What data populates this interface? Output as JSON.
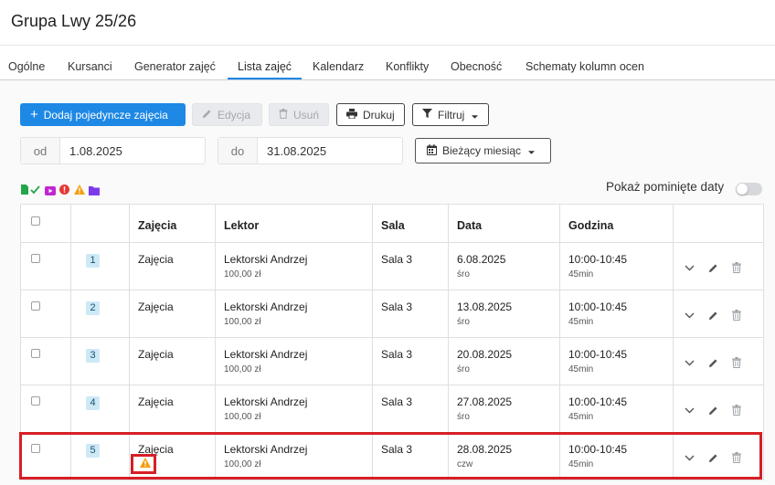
{
  "page": {
    "title": "Grupa Lwy 25/26"
  },
  "tabs": [
    {
      "label": "Ogólne"
    },
    {
      "label": "Kursanci"
    },
    {
      "label": "Generator zajęć"
    },
    {
      "label": "Lista zajęć",
      "active": true
    },
    {
      "label": "Kalendarz"
    },
    {
      "label": "Konflikty"
    },
    {
      "label": "Obecność"
    },
    {
      "label": "Schematy kolumn ocen"
    }
  ],
  "toolbar": {
    "add_label": "Dodaj pojedyncze zajęcia",
    "edit_label": "Edycja",
    "delete_label": "Usuń",
    "print_label": "Drukuj",
    "filter_label": "Filtruj"
  },
  "filters": {
    "from_prefix": "od",
    "from_value": "1.08.2025",
    "to_prefix": "do",
    "to_value": "31.08.2025",
    "period_label": "Bieżący miesiąc"
  },
  "legend_icons": [
    "file-icon",
    "check-icon",
    "video-icon",
    "alert-circle-icon",
    "warning-icon",
    "folder-icon"
  ],
  "toggle": {
    "label": "Pokaż pominięte daty",
    "on": false
  },
  "table": {
    "headers": [
      "Zajęcia",
      "Lektor",
      "Sala",
      "Data",
      "Godzina"
    ],
    "rows": [
      {
        "num": "1",
        "name": "Zajęcia",
        "lecturer": "Lektorski Andrzej",
        "price": "100,00 zł",
        "room": "Sala 3",
        "date": "6.08.2025",
        "day": "śro",
        "time": "10:00-10:45",
        "duration": "45min",
        "warning": false
      },
      {
        "num": "2",
        "name": "Zajęcia",
        "lecturer": "Lektorski Andrzej",
        "price": "100,00 zł",
        "room": "Sala 3",
        "date": "13.08.2025",
        "day": "śro",
        "time": "10:00-10:45",
        "duration": "45min",
        "warning": false
      },
      {
        "num": "3",
        "name": "Zajęcia",
        "lecturer": "Lektorski Andrzej",
        "price": "100,00 zł",
        "room": "Sala 3",
        "date": "20.08.2025",
        "day": "śro",
        "time": "10:00-10:45",
        "duration": "45min",
        "warning": false
      },
      {
        "num": "4",
        "name": "Zajęcia",
        "lecturer": "Lektorski Andrzej",
        "price": "100,00 zł",
        "room": "Sala 3",
        "date": "27.08.2025",
        "day": "śro",
        "time": "10:00-10:45",
        "duration": "45min",
        "warning": false
      },
      {
        "num": "5",
        "name": "Zajęcia",
        "lecturer": "Lektorski Andrzej",
        "price": "100,00 zł",
        "room": "Sala 3",
        "date": "28.08.2025",
        "day": "czw",
        "time": "10:00-10:45",
        "duration": "45min",
        "warning": true
      }
    ]
  },
  "colors": {
    "accent": "#1e88e5",
    "highlight": "#d61f26",
    "warning": "#f59e0b",
    "badge": "#cde9f6"
  }
}
